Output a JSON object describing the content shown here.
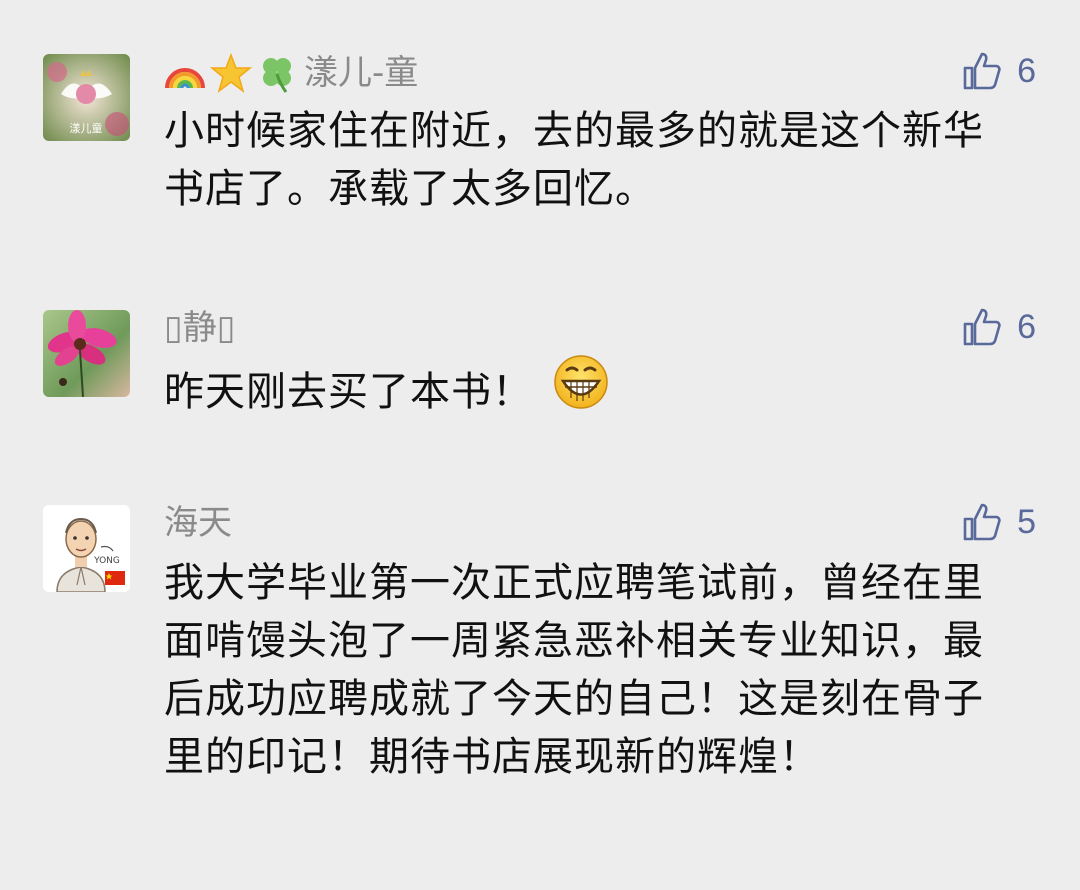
{
  "comments": [
    {
      "name_emojis": [
        "rainbow-icon",
        "glowing-star-icon",
        "four-leaf-clover-icon"
      ],
      "name": "漾儿-童",
      "likes": "6",
      "text": "小时候家住在附近，去的最多的就是这个新华书店了。承载了太多回忆。",
      "avatar_text": "漾儿童"
    },
    {
      "name": "▯静▯",
      "likes": "6",
      "text": "昨天刚去买了本书！",
      "text_emoji": "grinning-face-icon"
    },
    {
      "name": "海天",
      "likes": "5",
      "text": "我大学毕业第一次正式应聘笔试前，曾经在里面啃馒头泡了一周紧急恶补相关专业知识，最后成功应聘成就了今天的自己！这是刻在骨子里的印记！期待书店展现新的辉煌！",
      "avatar_text": "YONG"
    }
  ],
  "colors": {
    "background": "#ededed",
    "name": "#8a8a8a",
    "like_accent": "#58699a",
    "text": "#111111"
  }
}
